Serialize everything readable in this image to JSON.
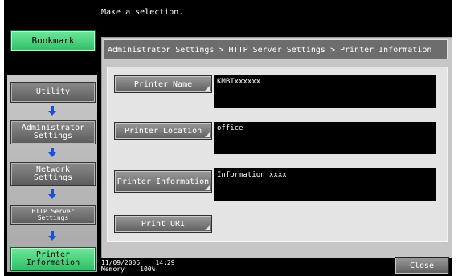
{
  "header": {
    "message": "Make a selection."
  },
  "bookmark": {
    "label": "Bookmark"
  },
  "nav": {
    "utility": "Utility",
    "admin_line1": "Administrator",
    "admin_line2": "Settings",
    "network_line1": "Network",
    "network_line2": "Settings",
    "http_line1": "HTTP Server",
    "http_line2": "Settings",
    "printer_line1": "Printer",
    "printer_line2": "Information"
  },
  "main": {
    "breadcrumb": "Administrator Settings > HTTP Server Settings > Printer Information",
    "fields": [
      {
        "label": "Printer Name",
        "value": "KMBTxxxxxx"
      },
      {
        "label": "Printer Location",
        "value": "office"
      },
      {
        "label": "Printer Information",
        "value": "Information xxxx"
      },
      {
        "label": "Print URI",
        "value": ""
      }
    ]
  },
  "status": {
    "date": "11/09/2006",
    "time": "14:29",
    "memory_label": "Memory",
    "memory_value": "100%"
  },
  "close": {
    "label": "Close"
  },
  "colors": {
    "accent_green": "#2fbe66",
    "arrow_blue": "#1a4fd6"
  }
}
